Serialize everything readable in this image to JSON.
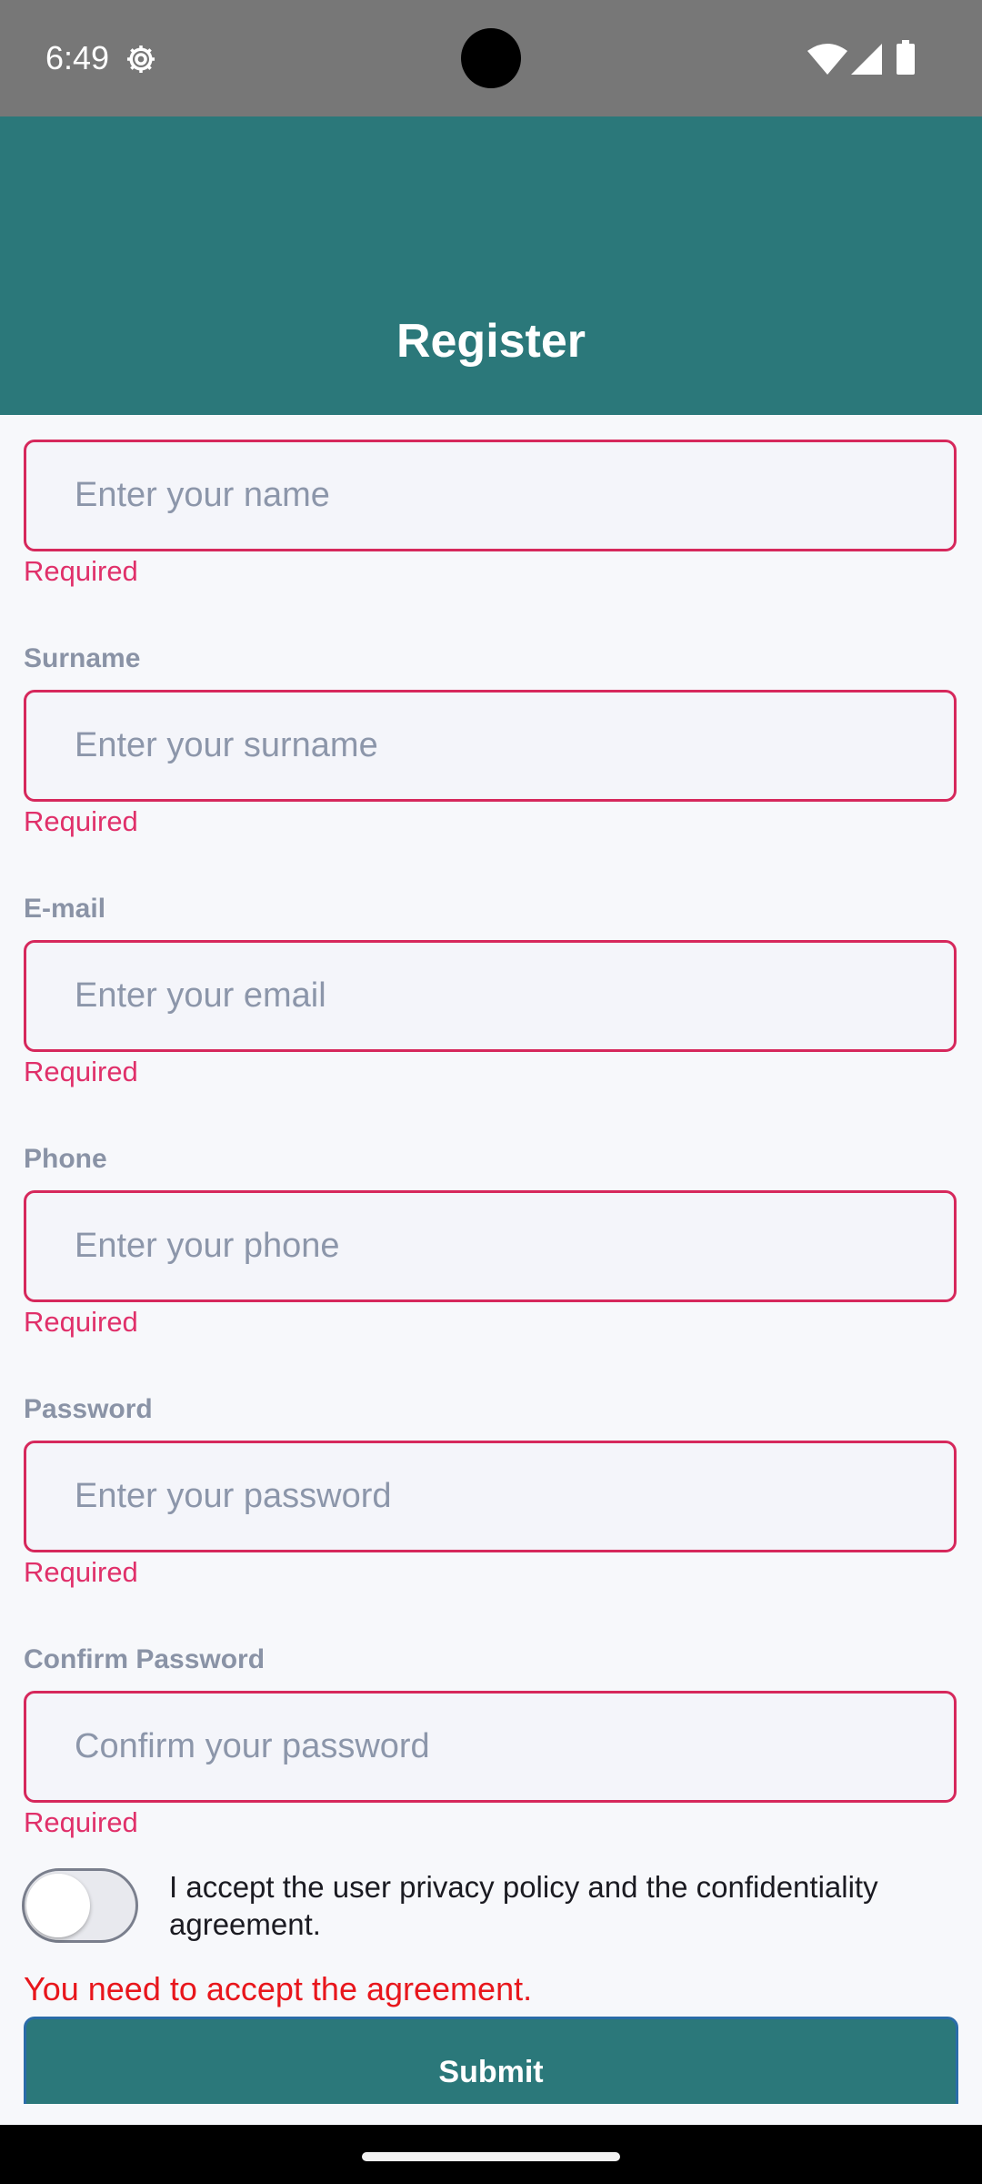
{
  "status_bar": {
    "time": "6:49"
  },
  "header": {
    "title": "Register"
  },
  "form": {
    "fields": [
      {
        "label": "",
        "placeholder": "Enter your name",
        "value": "",
        "error": "Required"
      },
      {
        "label": "Surname",
        "placeholder": "Enter your surname",
        "value": "",
        "error": "Required"
      },
      {
        "label": "E-mail",
        "placeholder": "Enter your email",
        "value": "",
        "error": "Required"
      },
      {
        "label": "Phone",
        "placeholder": "Enter your phone",
        "value": "",
        "error": "Required"
      },
      {
        "label": "Password",
        "placeholder": "Enter your password",
        "value": "",
        "error": "Required"
      },
      {
        "label": "Confirm Password",
        "placeholder": "Confirm your password",
        "value": "",
        "error": "Required"
      }
    ],
    "agreement": {
      "text": "I accept the user privacy policy and the confidentiality agreement.",
      "accepted": false,
      "error": "You need to accept the agreement."
    },
    "submit_label": "Submit"
  },
  "icons": {
    "status_gear": "gear-icon",
    "status_wifi": "wifi-icon",
    "status_signal": "signal-icon",
    "status_battery": "battery-icon"
  },
  "colors": {
    "header_bg": "#2b787a",
    "error_border": "#d6285c",
    "error_text": "#e0306a",
    "agreement_error": "#e8161c",
    "status_bar_bg": "#777777"
  }
}
